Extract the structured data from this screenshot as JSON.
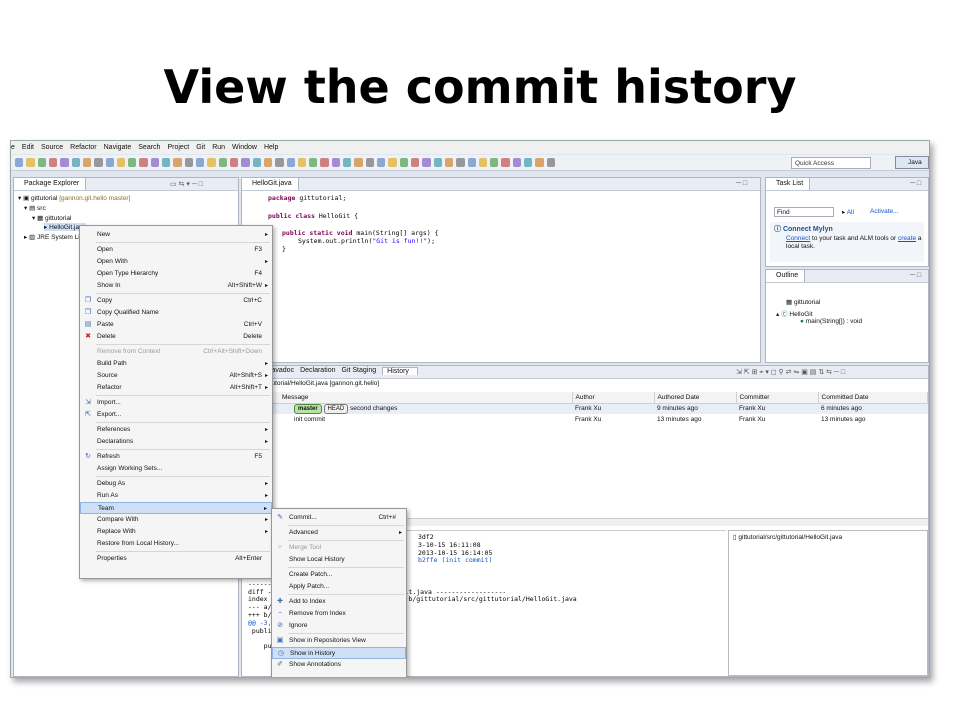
{
  "slide": {
    "title": "View the commit history"
  },
  "menubar": [
    "e",
    "Edit",
    "Source",
    "Refactor",
    "Navigate",
    "Search",
    "Project",
    "Git",
    "Run",
    "Window",
    "Help"
  ],
  "toolbar": {
    "quick_access": "Quick Access",
    "perspective": "Java"
  },
  "package_explorer": {
    "tab": "Package Explorer",
    "tree": [
      {
        "label": "gittutorial",
        "extra": "[gannon.git.hello master]"
      },
      {
        "label": "src"
      },
      {
        "label": "gittutorial"
      },
      {
        "label": "HelloGit.java"
      },
      {
        "label": "JRE System Li"
      }
    ]
  },
  "editor": {
    "tab": "HelloGit.java",
    "lines": [
      {
        "kw": "package",
        "rest": " gittutorial;"
      },
      {
        "kw": "public class",
        "rest": " HelloGit {"
      },
      {
        "kw": "public static void",
        "rest": " main(String[] args) {"
      },
      {
        "plain": "System.out.println(",
        "str": "\"Git is fun!!\"",
        "tail": ");"
      },
      {
        "plain": "}"
      }
    ]
  },
  "context_menu": {
    "items": [
      {
        "label": "New",
        "arrow": true
      },
      {
        "sep": true
      },
      {
        "label": "Open",
        "shortcut": "F3"
      },
      {
        "label": "Open With",
        "arrow": true
      },
      {
        "label": "Open Type Hierarchy",
        "shortcut": "F4"
      },
      {
        "label": "Show In",
        "shortcut": "Alt+Shift+W",
        "arrow": true
      },
      {
        "sep": true
      },
      {
        "label": "Copy",
        "shortcut": "Ctrl+C",
        "icon": "copy-icon"
      },
      {
        "label": "Copy Qualified Name",
        "icon": "copy-icon"
      },
      {
        "label": "Paste",
        "shortcut": "Ctrl+V",
        "icon": "paste-icon"
      },
      {
        "label": "Delete",
        "shortcut": "Delete",
        "icon": "delete-icon"
      },
      {
        "sep": true
      },
      {
        "label": "Remove from Context",
        "shortcut": "Ctrl+Alt+Shift+Down",
        "disabled": true
      },
      {
        "label": "Build Path",
        "arrow": true
      },
      {
        "label": "Source",
        "shortcut": "Alt+Shift+S",
        "arrow": true
      },
      {
        "label": "Refactor",
        "shortcut": "Alt+Shift+T",
        "arrow": true
      },
      {
        "sep": true
      },
      {
        "label": "Import...",
        "icon": "import-icon"
      },
      {
        "label": "Export...",
        "icon": "export-icon"
      },
      {
        "sep": true
      },
      {
        "label": "References",
        "arrow": true
      },
      {
        "label": "Declarations",
        "arrow": true
      },
      {
        "sep": true
      },
      {
        "label": "Refresh",
        "shortcut": "F5",
        "icon": "refresh-icon"
      },
      {
        "label": "Assign Working Sets..."
      },
      {
        "sep": true
      },
      {
        "label": "Debug As",
        "arrow": true
      },
      {
        "label": "Run As",
        "arrow": true
      },
      {
        "label": "Team",
        "arrow": true,
        "highlight": true
      },
      {
        "label": "Compare With",
        "arrow": true
      },
      {
        "label": "Replace With",
        "arrow": true
      },
      {
        "label": "Restore from Local History..."
      },
      {
        "sep": true
      },
      {
        "label": "Properties",
        "shortcut": "Alt+Enter"
      }
    ]
  },
  "team_menu": {
    "items": [
      {
        "label": "Commit...",
        "shortcut": "Ctrl+#",
        "icon": "commit-icon"
      },
      {
        "sep": true
      },
      {
        "label": "Advanced",
        "arrow": true
      },
      {
        "sep": true
      },
      {
        "label": "Merge Tool",
        "disabled": true,
        "icon": "merge-icon"
      },
      {
        "label": "Show Local History"
      },
      {
        "sep": true
      },
      {
        "label": "Create Patch..."
      },
      {
        "label": "Apply Patch..."
      },
      {
        "sep": true
      },
      {
        "label": "Add to Index",
        "icon": "add-icon"
      },
      {
        "label": "Remove from Index",
        "icon": "remove-icon"
      },
      {
        "label": "Ignore",
        "icon": "ignore-icon"
      },
      {
        "sep": true
      },
      {
        "label": "Show in Repositories View",
        "icon": "repo-icon"
      },
      {
        "label": "Show in History",
        "icon": "history-icon",
        "highlight": true
      },
      {
        "label": "Show Annotations",
        "icon": "annotate-icon"
      }
    ]
  },
  "task_list": {
    "tab": "Task List",
    "find": "Find",
    "all": "All",
    "activate": "Activate...",
    "mylyn_title": "Connect Mylyn",
    "mylyn_link1": "Connect",
    "mylyn_text": " to your task and ALM tools or ",
    "mylyn_link2": "create",
    "mylyn_text2": " a",
    "mylyn_text3": "local task."
  },
  "outline": {
    "tab": "Outline",
    "items": [
      "gittutorial",
      "HelloGit",
      "main(String[]) : void"
    ]
  },
  "bottom": {
    "tabs": [
      "Javadoc",
      "Declaration",
      "Git Staging",
      "History"
    ],
    "path": "ial/src/gittutorial/HelloGit.java [gannon.git.hello]",
    "columns": [
      "Message",
      "Author",
      "Authored Date",
      "Committer",
      "Committed Date"
    ],
    "rows": [
      {
        "branch": "master",
        "head": "HEAD",
        "message": "second changes",
        "author": "Frank Xu",
        "authored": "9 minutes ago",
        "committer": "Frank Xu",
        "committed": "6 minutes ago"
      },
      {
        "message": "init commit",
        "author": "Frank Xu",
        "authored": "13 minutes ago",
        "committer": "Frank Xu",
        "committed": "13 minutes ago"
      }
    ],
    "detail_lines": [
      "3df2",
      "3-10-15 16:11:08",
      "2013-10-15 16:14:05",
      "b2ffe (init commit)",
      "",
      "second c",
      "-------",
      "diff --g                      ial/HelloGit.java ------------------",
      "index 33                      loGit.java b/gittutorial/src/gittutorial/HelloGit.java",
      "--- a/gi                      java",
      "+++ b/gi                      java",
      "@@ -3,6",
      " public",
      "",
      "    publ                      {"
    ],
    "file": "gittutorial/src/gittutorial/HelloGit.java"
  }
}
